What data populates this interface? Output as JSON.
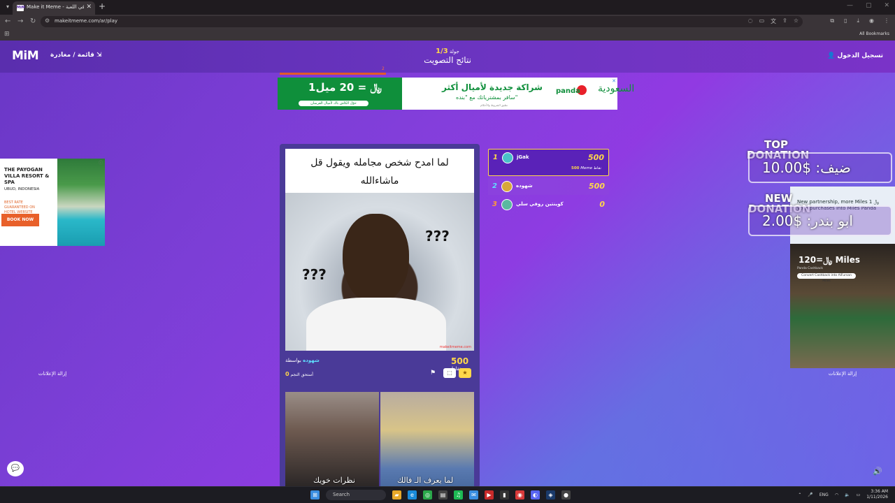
{
  "browser": {
    "tab_title": "Make it Meme - جولة 1/3 في اللعبة",
    "url": "makeitmeme.com/ar/play",
    "all_bookmarks": "All Bookmarks",
    "tab_favicon": "MiM"
  },
  "header": {
    "logo": "MiM",
    "menu_label": "قائمة / مغادرة",
    "round_label": "جولة",
    "round_value": "1/3",
    "title": "نتائج التصويت",
    "login_label": "تسجيل الدخول",
    "progress_mark": "2"
  },
  "ads": {
    "top": {
      "price": "1﷼ = 20 ميل",
      "price_small": "حوّل الكاش باك لأميال الفرسان",
      "headline": "شراكة جديدة لأميال أكثر",
      "sub": "سافر بمشترياتك مع \"بنده\"",
      "note": "تطبق الشروط والأحكام",
      "panda": "panda",
      "saudia": "السعودية"
    },
    "left": {
      "title": "THE PAYOGAN VILLA RESORT & SPA",
      "location": "UBUD, INDONESIA",
      "small": "BEST RATE GUARANTEED ON HOTEL WEBSITE",
      "button": "BOOK NOW",
      "remove": "إزالة الإعلانات"
    },
    "right": {
      "text": "New partnership, more Miles\n1 ﷼ your purchases into Miles Panda",
      "price": "1﷼=20 Miles",
      "sub": "Panda Cashback",
      "button": "Convert Cashback into AlFursan Miles",
      "remove": "إزالة الإعلانات"
    }
  },
  "meme": {
    "caption": "لما امدح شخص مجامله ويقول قل ماشاءالله",
    "q1": "???",
    "q2": "???",
    "watermark": "makeitmeme.com",
    "by_label": "بواسطة",
    "author": "شهوده",
    "points_label": "نقاط",
    "points": "500",
    "deserve_label": "أستحق النجم",
    "deserve_value": "0"
  },
  "meme2": {
    "sub_left": "نظرات خويك",
    "sub_right": "لما يعرف الـ فالك"
  },
  "leaderboard": [
    {
      "rank": "1",
      "name": "jGak",
      "score": "500",
      "sub_label": "نقاط",
      "sub_value": "500",
      "sub_tag": "Meme",
      "color": "#ffd84a"
    },
    {
      "rank": "2",
      "name": "شهوده",
      "score": "500",
      "color": "#5fe0ff"
    },
    {
      "rank": "3",
      "name": "كوينتين روفي سلي",
      "score": "0",
      "color": "#ff9a3a"
    }
  ],
  "donations": {
    "top_label_1": "TOP",
    "top_label_2": "DONATION",
    "top_value": "ضيف: $10.00",
    "new_label_1": "NEW",
    "new_label_2": "DONATION",
    "new_value": "ابو بندر: $2.00"
  },
  "taskbar": {
    "search_placeholder": "Search",
    "lang": "ENG",
    "time": "3:36 AM",
    "date": "1/11/2026"
  },
  "icons": {
    "chat": "chat-icon",
    "sound": "speaker-icon"
  }
}
